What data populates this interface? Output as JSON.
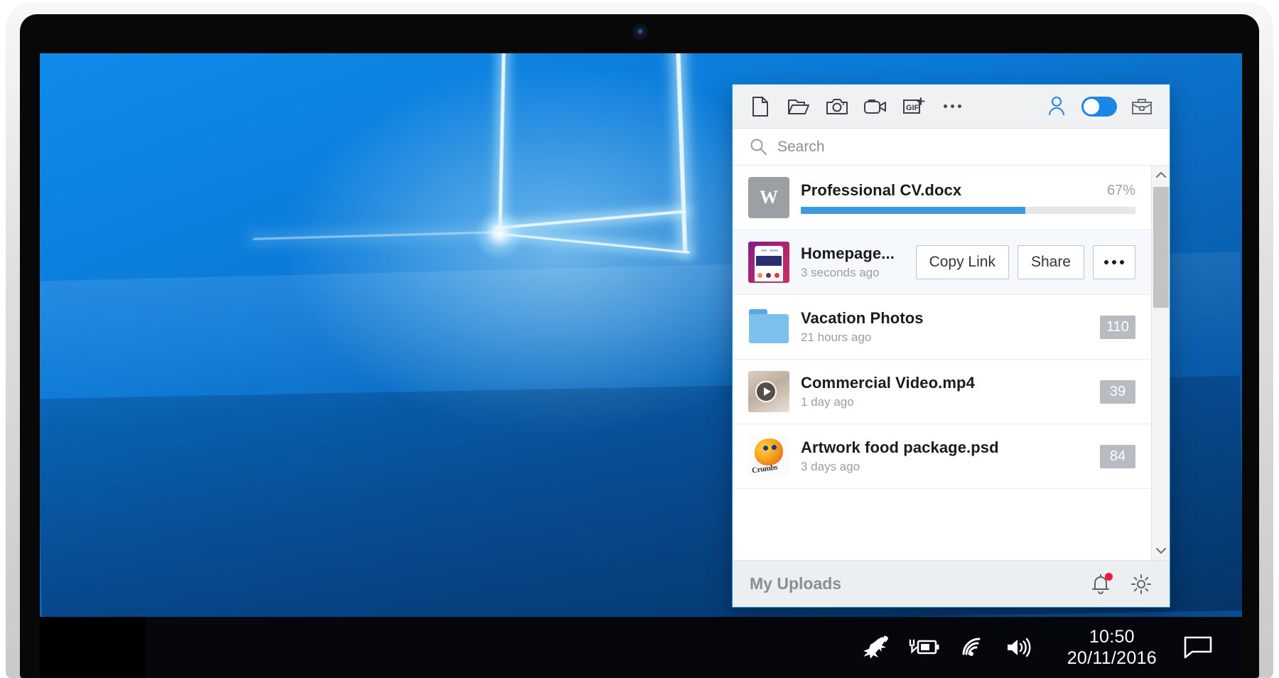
{
  "device": {
    "type": "laptop",
    "webcam": "webcam-lens"
  },
  "desktop": {
    "wallpaper": "windows-10-hero-blue",
    "taskbar": {
      "tray": [
        {
          "name": "kangaroo-icon",
          "label": "Kangaroo"
        },
        {
          "name": "battery-charging-icon",
          "label": "Battery charging"
        },
        {
          "name": "wifi-icon",
          "label": "Wi-Fi"
        },
        {
          "name": "volume-icon",
          "label": "Volume"
        }
      ],
      "clock": {
        "time": "10:50",
        "date": "20/11/2016"
      },
      "action_center": {
        "name": "action-center-icon",
        "label": "Notifications"
      }
    }
  },
  "panel": {
    "accent_color": "#1b87e4",
    "border_color": "#1d8fe0",
    "toolbar": {
      "left_items": [
        {
          "name": "new-file-icon",
          "label": "New file"
        },
        {
          "name": "open-folder-icon",
          "label": "Open folder"
        },
        {
          "name": "camera-icon",
          "label": "Screenshot"
        },
        {
          "name": "video-camera-icon",
          "label": "Record video"
        },
        {
          "name": "gif-plus-icon",
          "label": "GIF",
          "badge": "+"
        },
        {
          "name": "more-options-icon",
          "label": "More"
        }
      ],
      "right_items": [
        {
          "name": "person-icon",
          "label": "Account"
        },
        {
          "name": "mode-toggle",
          "label": "Work mode",
          "state": "on"
        },
        {
          "name": "briefcase-icon",
          "label": "Team"
        }
      ]
    },
    "search": {
      "placeholder": "Search",
      "value": "",
      "icon": "search-icon"
    },
    "items": [
      {
        "name": "Professional CV.docx",
        "subtitle": "",
        "kind": "upload-in-progress",
        "thumb": "word-doc",
        "thumb_letter": "W",
        "percent_label": "67%",
        "percent": 67
      },
      {
        "name": "Homepage...",
        "subtitle": "3 seconds ago",
        "kind": "hovered",
        "thumb": "website-mockup",
        "actions": [
          {
            "name": "copy-link-button",
            "label": "Copy Link"
          },
          {
            "name": "share-button",
            "label": "Share"
          },
          {
            "name": "more-actions-button",
            "label": "•••"
          }
        ]
      },
      {
        "name": "Vacation Photos",
        "subtitle": "21 hours ago",
        "kind": "folder",
        "thumb": "folder",
        "badge": "110"
      },
      {
        "name": "Commercial Video.mp4",
        "subtitle": "1 day ago",
        "kind": "video",
        "thumb": "video-thumbnail",
        "badge": "39"
      },
      {
        "name": "Artwork food package.psd",
        "subtitle": "3 days ago",
        "kind": "image",
        "thumb": "psd-artwork",
        "thumb_word": "Crumbs",
        "badge": "84"
      }
    ],
    "scrollbar": {
      "up": "chevron-up-icon",
      "down": "chevron-down-icon",
      "thumb": "scrollbar-thumb"
    },
    "footer": {
      "title": "My Uploads",
      "notifications": {
        "name": "bell-icon",
        "has_unread": true,
        "dot_color": "#f5143c"
      },
      "settings": {
        "name": "gear-icon",
        "label": "Settings"
      }
    }
  }
}
